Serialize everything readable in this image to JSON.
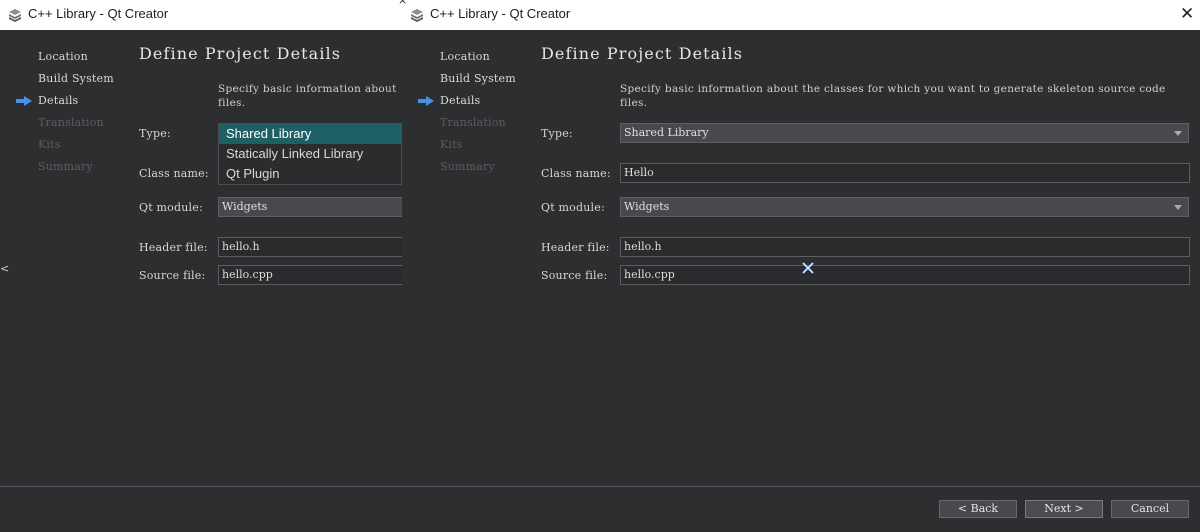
{
  "windows": [
    {
      "title": "C++ Library - Qt Creator",
      "icon": "qt-creator-stack-icon",
      "steps": [
        "Location",
        "Build System",
        "Details",
        "Translation",
        "Kits",
        "Summary"
      ],
      "active_step": "Details",
      "heading": "Define Project Details",
      "description": "Specify basic information about the classes for which you want to generate skeleton source code files.",
      "description_visible": "Specify basic information about\nfiles.",
      "fields": {
        "type_label": "Type:",
        "class_label": "Class name:",
        "qt_module_label": "Qt module:",
        "qt_module_value": "Widgets",
        "header_label": "Header file:",
        "header_value": "hello.h",
        "source_label": "Source file:",
        "source_value": "hello.cpp"
      },
      "type_dropdown_open": true,
      "type_options": [
        "Shared Library",
        "Statically Linked Library",
        "Qt Plugin"
      ],
      "type_selected": "Shared Library"
    },
    {
      "title": "C++ Library - Qt Creator",
      "icon": "qt-creator-stack-icon",
      "close_glyph": "✕",
      "steps": [
        "Location",
        "Build System",
        "Details",
        "Translation",
        "Kits",
        "Summary"
      ],
      "active_step": "Details",
      "heading": "Define Project Details",
      "description": "Specify basic information about the classes for which you want to generate skeleton source code files.",
      "fields": {
        "type_label": "Type:",
        "type_value": "Shared Library",
        "class_label": "Class name:",
        "class_value": "Hello",
        "qt_module_label": "Qt module:",
        "qt_module_value": "Widgets",
        "header_label": "Header file:",
        "header_value": "hello.h",
        "source_label": "Source file:",
        "source_value": "hello.cpp"
      }
    }
  ],
  "buttons": {
    "back": "< Back",
    "next": "Next >",
    "cancel": "Cancel"
  },
  "colors": {
    "background": "#2d2e30",
    "accent_selection": "#1f5f66",
    "active_arrow": "#4a8ee8"
  }
}
